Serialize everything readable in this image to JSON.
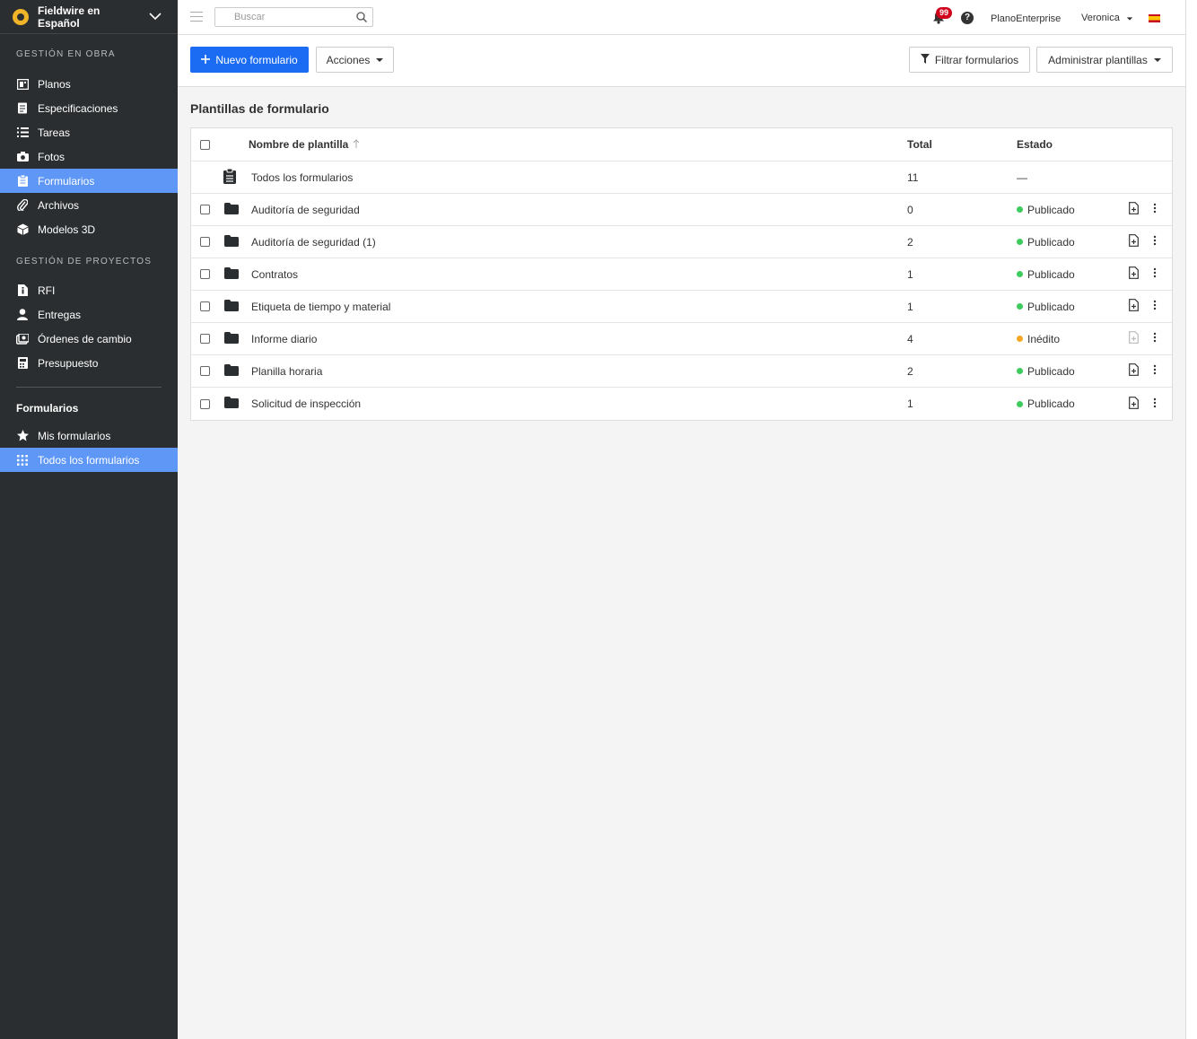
{
  "project": {
    "name": "Fieldwire en Español"
  },
  "sidebar": {
    "section1_title": "GESTIÓN EN OBRA",
    "section1_items": [
      {
        "label": "Planos",
        "icon": "plans-icon"
      },
      {
        "label": "Especificaciones",
        "icon": "specs-icon"
      },
      {
        "label": "Tareas",
        "icon": "list-icon"
      },
      {
        "label": "Fotos",
        "icon": "camera-icon"
      },
      {
        "label": "Formularios",
        "icon": "clipboard-icon",
        "active": true
      },
      {
        "label": "Archivos",
        "icon": "paperclip-icon"
      },
      {
        "label": "Modelos 3D",
        "icon": "cube-icon"
      }
    ],
    "section2_title": "GESTIÓN DE PROYECTOS",
    "section2_items": [
      {
        "label": "RFI",
        "icon": "document-info-icon"
      },
      {
        "label": "Entregas",
        "icon": "person-icon"
      },
      {
        "label": "Órdenes de cambio",
        "icon": "change-order-icon"
      },
      {
        "label": "Presupuesto",
        "icon": "calculator-icon"
      }
    ],
    "sub_title": "Formularios",
    "sub_items": [
      {
        "label": "Mis formularios",
        "icon": "star-icon"
      },
      {
        "label": "Todos los formularios",
        "icon": "grid-icon",
        "active": true
      }
    ]
  },
  "topbar": {
    "search_placeholder": "Buscar",
    "notifications_count": "99",
    "help": "?",
    "plan": "PlanoEnterprise",
    "user": "Veronica"
  },
  "toolbar": {
    "new_form": "Nuevo formulario",
    "actions": "Acciones",
    "filter": "Filtrar formularios",
    "manage": "Administrar plantillas"
  },
  "main": {
    "title": "Plantillas de formulario",
    "columns": {
      "name": "Nombre de plantilla",
      "total": "Total",
      "status": "Estado"
    },
    "all_row": {
      "name": "Todos los formularios",
      "total": "11",
      "status": "—"
    },
    "rows": [
      {
        "name": "Auditoría de seguridad",
        "total": "0",
        "status": "Publicado",
        "status_color": "#3ecb5e"
      },
      {
        "name": "Auditoría de seguridad (1)",
        "total": "2",
        "status": "Publicado",
        "status_color": "#3ecb5e"
      },
      {
        "name": "Contratos",
        "total": "1",
        "status": "Publicado",
        "status_color": "#3ecb5e"
      },
      {
        "name": "Etiqueta de tiempo y material",
        "total": "1",
        "status": "Publicado",
        "status_color": "#3ecb5e"
      },
      {
        "name": "Informe diario",
        "total": "4",
        "status": "Inédito",
        "status_color": "#f5a623"
      },
      {
        "name": "Planilla horaria",
        "total": "2",
        "status": "Publicado",
        "status_color": "#3ecb5e"
      },
      {
        "name": "Solicitud de inspección",
        "total": "1",
        "status": "Publicado",
        "status_color": "#3ecb5e"
      }
    ]
  },
  "colors": {
    "primary": "#1b6cf2",
    "sidebar_bg": "#2b2e30",
    "sidebar_active": "#5e97f6"
  }
}
